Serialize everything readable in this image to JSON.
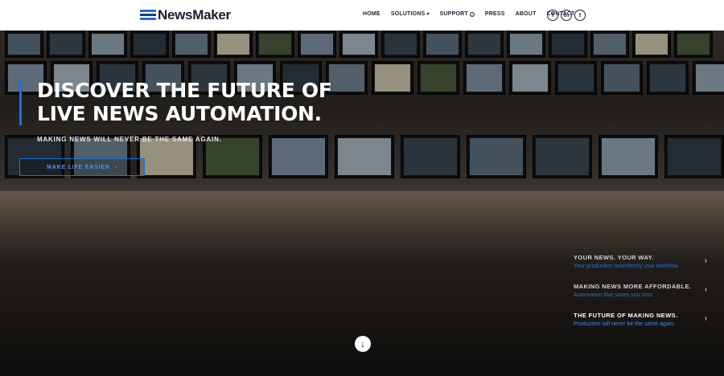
{
  "header": {
    "logo_text": "NewsMaker",
    "nav": [
      {
        "label": "HOME"
      },
      {
        "label": "SOLUTIONS",
        "icon": "chevron-down-icon"
      },
      {
        "label": "SUPPORT",
        "icon": "help-icon"
      },
      {
        "label": "PRESS"
      },
      {
        "label": "ABOUT"
      },
      {
        "label": "CONTACT"
      }
    ],
    "social": [
      {
        "name": "facebook-icon",
        "glyph": "f"
      },
      {
        "name": "linkedin-icon",
        "glyph": "in"
      },
      {
        "name": "twitter-icon",
        "glyph": "t"
      }
    ]
  },
  "hero": {
    "headline": "DISCOVER THE FUTURE OF LIVE NEWS AUTOMATION.",
    "subline": "MAKING NEWS WILL NEVER BE THE SAME AGAIN.",
    "cta_label": "MAKE LIFE EASIER",
    "cta_arrow": "›",
    "accent_color": "#1d6fe0"
  },
  "slides": [
    {
      "title": "YOUR NEWS. YOUR WAY.",
      "subtitle": "Your production seamlessly your workflow.",
      "active": false
    },
    {
      "title": "MAKING NEWS MORE AFFORDABLE.",
      "subtitle": "Automation that saves you cost.",
      "active": false
    },
    {
      "title": "THE FUTURE OF MAKING NEWS.",
      "subtitle": "Production will never be the same again.",
      "active": true
    }
  ],
  "scroll_down_icon": "arrow-down-circle-icon"
}
